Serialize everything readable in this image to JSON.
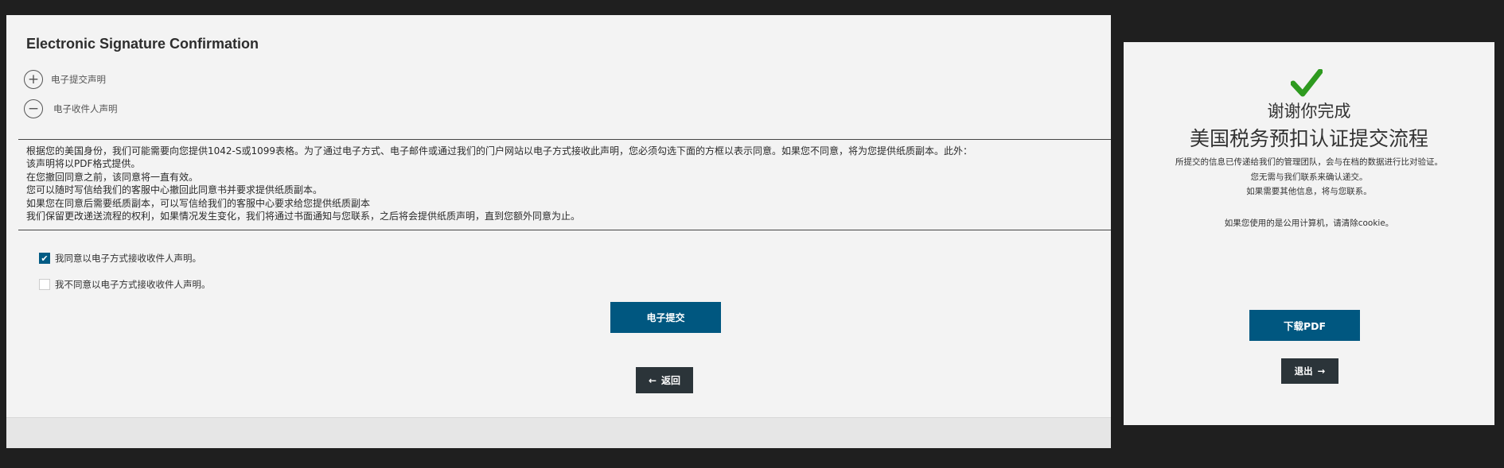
{
  "left_panel": {
    "title": "Electronic Signature Confirmation",
    "accordion": [
      {
        "label": "电子提交声明",
        "icon": "plus-circle-icon",
        "expanded": false
      },
      {
        "label": "电子收件人声明",
        "icon": "minus-circle-icon",
        "expanded": true
      }
    ],
    "statement_lines": [
      "根据您的美国身份，我们可能需要向您提供1042-S或1099表格。为了通过电子方式、电子邮件或通过我们的门户网站以电子方式接收此声明，您必须勾选下面的方框以表示同意。如果您不同意，将为您提供纸质副本。此外：",
      "该声明将以PDF格式提供。",
      "在您撤回同意之前，该同意将一直有效。",
      "您可以随时写信给我们的客服中心撤回此同意书并要求提供纸质副本。",
      "如果您在同意后需要纸质副本，可以写信给我们的客服中心要求给您提供纸质副本",
      "我们保留更改递送流程的权利，如果情况发生变化，我们将通过书面通知与您联系，之后将会提供纸质声明，直到您额外同意为止。"
    ],
    "checkboxes": [
      {
        "label": "我同意以电子方式接收收件人声明。",
        "checked": true
      },
      {
        "label": "我不同意以电子方式接收收件人声明。",
        "checked": false
      }
    ],
    "submit_label": "电子提交",
    "back_label": "返回",
    "back_icon": "arrow-left-icon"
  },
  "right_panel": {
    "icon": "green-checkmark-icon",
    "title_line1": "谢谢你完成",
    "title_line2": "美国税务预扣认证提交流程",
    "messages": [
      "所提交的信息已传递给我们的管理团队，会与在档的数据进行比对验证。",
      "您无需与我们联系来确认递交。",
      "如果需要其他信息，将与您联系。"
    ],
    "cookie_note": "如果您使用的是公用计算机，请清除cookie。",
    "download_label": "下载PDF",
    "exit_label": "退出",
    "exit_icon": "arrow-right-icon"
  },
  "colors": {
    "primary_button": "#005780",
    "dark_button": "#2b3439",
    "check_green": "#2e9a1f",
    "background": "#1f1f1f",
    "panel": "#f3f3f3"
  }
}
